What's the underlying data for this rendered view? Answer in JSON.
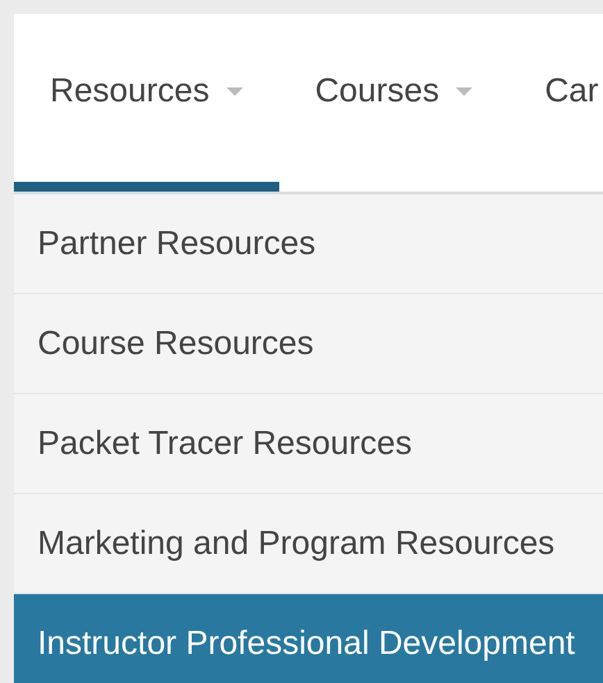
{
  "tabs": [
    {
      "label": "Resources",
      "has_menu": true,
      "selected": true
    },
    {
      "label": "Courses",
      "has_menu": true,
      "selected": false
    },
    {
      "label": "Car",
      "has_menu": false,
      "selected": false
    }
  ],
  "menu": {
    "items": [
      {
        "label": "Partner Resources",
        "selected": false
      },
      {
        "label": "Course Resources",
        "selected": false
      },
      {
        "label": "Packet Tracer Resources",
        "selected": false
      },
      {
        "label": "Marketing and Program Resources",
        "selected": false
      },
      {
        "label": "Instructor Professional Development",
        "selected": true
      }
    ]
  }
}
